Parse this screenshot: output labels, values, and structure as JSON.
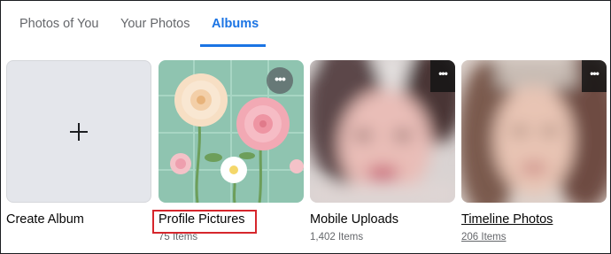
{
  "tabs": [
    {
      "label": "Photos of You",
      "active": false
    },
    {
      "label": "Your Photos",
      "active": false
    },
    {
      "label": "Albums",
      "active": true
    }
  ],
  "albums": [
    {
      "name": "Create Album",
      "count": ""
    },
    {
      "name": "Profile Pictures",
      "count": "75 Items",
      "highlighted": true
    },
    {
      "name": "Mobile Uploads",
      "count": "1,402 Items"
    },
    {
      "name": "Timeline Photos",
      "count": "206 Items",
      "underlined": true
    }
  ],
  "colors": {
    "accent": "#1b74e4",
    "highlight_box": "#d6262c",
    "tab_inactive": "#65676b"
  },
  "icons": {
    "create": "plus-icon",
    "more": "more-horizontal-icon"
  },
  "more_glyph": "•••"
}
